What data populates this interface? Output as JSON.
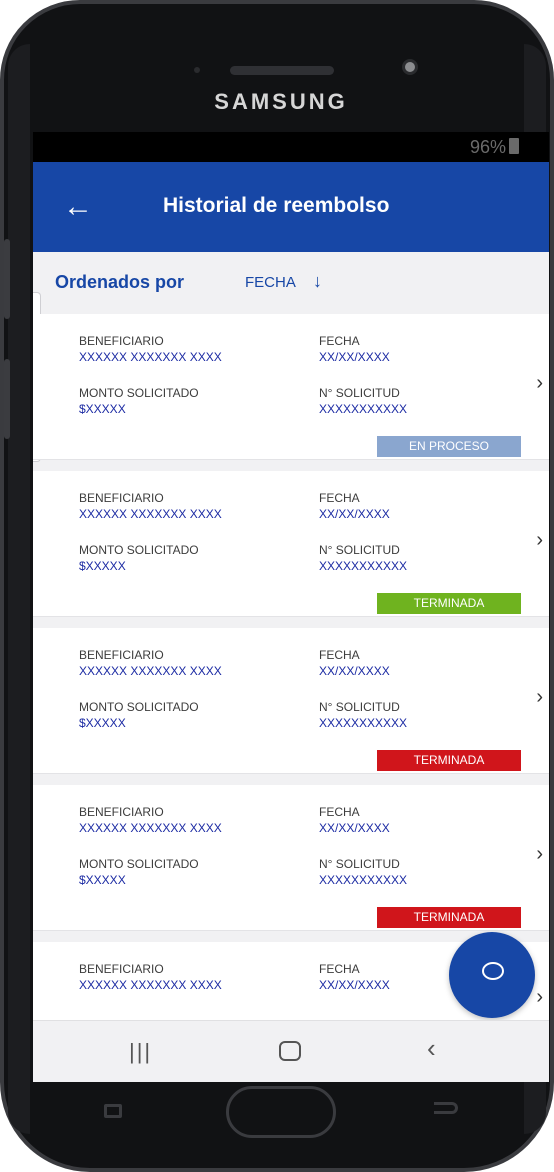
{
  "device": {
    "brand": "SAMSUNG"
  },
  "status_bar": {
    "battery": "96%"
  },
  "app_bar": {
    "title": "Historial de reembolso",
    "back_icon": "back-arrow-icon"
  },
  "sort": {
    "label": "Ordenados por",
    "field": "FECHA",
    "direction_icon": "arrow-down-icon"
  },
  "labels": {
    "beneficiary": "BENEFICIARIO",
    "date": "FECHA",
    "amount": "MONTO SOLICITADO",
    "request": "N° SOLICITUD"
  },
  "cards": [
    {
      "beneficiary": "XXXXXX XXXXXXX XXXX",
      "date": "XX/XX/XXXX",
      "amount": "$XXXXX",
      "request": "XXXXXXXXXXX",
      "status": "EN PROCESO",
      "status_color": "#8aa6cf"
    },
    {
      "beneficiary": "XXXXXX XXXXXXX XXXX",
      "date": "XX/XX/XXXX",
      "amount": "$XXXXX",
      "request": "XXXXXXXXXXX",
      "status": "TERMINADA",
      "status_color": "#6fb31f"
    },
    {
      "beneficiary": "XXXXXX XXXXXXX XXXX",
      "date": "XX/XX/XXXX",
      "amount": "$XXXXX",
      "request": "XXXXXXXXXXX",
      "status": "TERMINADA",
      "status_color": "#d0151b"
    },
    {
      "beneficiary": "XXXXXX XXXXXXX XXXX",
      "date": "XX/XX/XXXX",
      "amount": "$XXXXX",
      "request": "XXXXXXXXXXX",
      "status": "TERMINADA",
      "status_color": "#d0151b"
    },
    {
      "beneficiary": "XXXXXX XXXXXXX XXXX",
      "date": "XX/XX/XXXX",
      "amount": "",
      "request": "",
      "status": "",
      "status_color": ""
    }
  ],
  "colors": {
    "primary": "#1747a6",
    "value_text": "#1b2aa3",
    "background": "#f1f1f3"
  },
  "fab": {
    "icon": "chat-bubble-icon"
  },
  "nav": {
    "recent_icon": "recent-apps-icon",
    "home_icon": "home-icon",
    "back_icon": "back-chevron-icon"
  }
}
